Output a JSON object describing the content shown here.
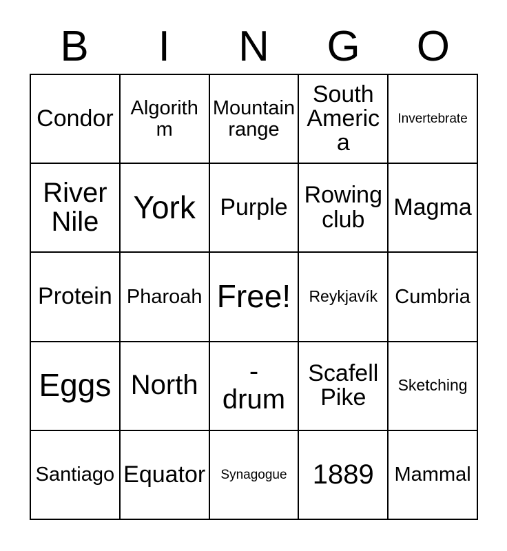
{
  "card": {
    "title": "BINGO",
    "header_letters": [
      "B",
      "I",
      "N",
      "G",
      "O"
    ],
    "free_space_label": "Free!",
    "colors": {
      "background": "#ffffff",
      "border": "#000000",
      "text": "#000000"
    },
    "grid": {
      "columns": 5,
      "rows": 5,
      "cells": [
        {
          "text": "Condor",
          "size": "lg"
        },
        {
          "text": "Algorithm",
          "size": "md"
        },
        {
          "text": "Mountain range",
          "size": "md"
        },
        {
          "text": "South America",
          "size": "lg"
        },
        {
          "text": "Invertebrate",
          "size": "xs"
        },
        {
          "text": "River Nile",
          "size": "xl"
        },
        {
          "text": "York",
          "size": "xxl"
        },
        {
          "text": "Purple",
          "size": "lg"
        },
        {
          "text": "Rowing club",
          "size": "lg"
        },
        {
          "text": "Magma",
          "size": "lg"
        },
        {
          "text": "Protein",
          "size": "lg"
        },
        {
          "text": "Pharoah",
          "size": "md"
        },
        {
          "text": "Free!",
          "size": "xxl"
        },
        {
          "text": "Reykjavík",
          "size": "sm"
        },
        {
          "text": "Cumbria",
          "size": "md"
        },
        {
          "text": "Eggs",
          "size": "xxl"
        },
        {
          "text": "North",
          "size": "xl"
        },
        {
          "text": "-\ndrum",
          "size": "xl"
        },
        {
          "text": "Scafell Pike",
          "size": "lg"
        },
        {
          "text": "Sketching",
          "size": "sm"
        },
        {
          "text": "Santiago",
          "size": "md"
        },
        {
          "text": "Equator",
          "size": "lg"
        },
        {
          "text": "Synagogue",
          "size": "xs"
        },
        {
          "text": "1889",
          "size": "xl"
        },
        {
          "text": "Mammal",
          "size": "md"
        }
      ]
    }
  }
}
